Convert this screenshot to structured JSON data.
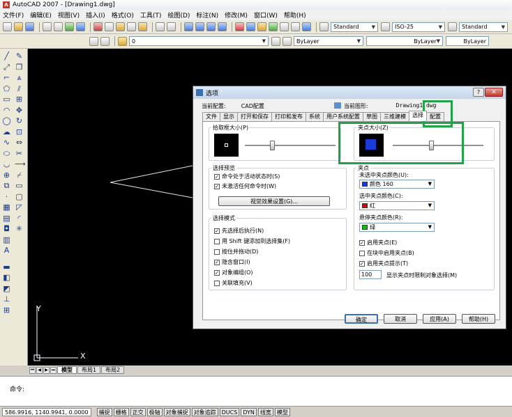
{
  "app": {
    "title": "AutoCAD 2007 - [Drawing1.dwg]",
    "logo": "A"
  },
  "menu": [
    "文件(F)",
    "编辑(E)",
    "视图(V)",
    "插入(I)",
    "格式(O)",
    "工具(T)",
    "绘图(D)",
    "标注(N)",
    "修改(M)",
    "窗口(W)",
    "帮助(H)"
  ],
  "toolbar": {
    "text_style": "Standard",
    "dim_style": "ISO-25",
    "table_style": "Standard",
    "layer_value": "0",
    "color": "ByLayer",
    "linetype": "ByLayer",
    "lineweight": "ByLayer"
  },
  "canvas": {
    "ucs_y": "Y",
    "ucs_x": "X"
  },
  "layout_tabs": {
    "nav": [
      "⏮",
      "◀",
      "▶",
      "⏭"
    ],
    "items": [
      "模型",
      "布局1",
      "布局2"
    ]
  },
  "command": {
    "prompt": "命令:"
  },
  "status": {
    "coords": "586.9916,  1140.9941, 0.0000",
    "buttons": [
      "捕捉",
      "栅格",
      "正交",
      "极轴",
      "对象捕捉",
      "对象追踪",
      "DUCS",
      "DYN",
      "线宽",
      "模型"
    ]
  },
  "dialog": {
    "title": "选项",
    "help_glyph": "?",
    "close_glyph": "✕",
    "current_profile_label": "当前配置:",
    "current_profile": "CAD配置",
    "current_drawing_label": "当前图形:",
    "current_drawing": "Drawing1.dwg",
    "tabs": [
      "文件",
      "显示",
      "打开和保存",
      "打印和发布",
      "系统",
      "用户系统配置",
      "草图",
      "三维建模",
      "选择",
      "配置"
    ],
    "active_tab": "选择",
    "pickbox": {
      "label": "拾取框大小(P)",
      "level": 0.3
    },
    "gripsize": {
      "label": "夹点大小(Z)",
      "level": 0.42
    },
    "selection_preview": {
      "label": "选择预览",
      "items": [
        {
          "label": "命令处于活动状态时(S)",
          "checked": true
        },
        {
          "label": "未激活任何命令时(W)",
          "checked": true
        }
      ],
      "button": "视觉效果设置(G)..."
    },
    "selection_modes": {
      "label": "选择模式",
      "items": [
        {
          "label": "先选择后执行(N)",
          "checked": true
        },
        {
          "label": "用 Shift 键添加到选择集(F)",
          "checked": false
        },
        {
          "label": "按住并拖动(D)",
          "checked": false
        },
        {
          "label": "隐含窗口(I)",
          "checked": true
        },
        {
          "label": "对象编组(O)",
          "checked": true
        },
        {
          "label": "关联填充(V)",
          "checked": false
        }
      ]
    },
    "grips": {
      "label": "夹点",
      "unselected_label": "未选中夹点颜色(U):",
      "unselected_value": "颜色 160",
      "unselected_color": "#1a3bd6",
      "selected_label": "选中夹点颜色(C):",
      "selected_value": "红",
      "selected_color": "#e00000",
      "hover_label": "悬停夹点颜色(R):",
      "hover_value": "绿",
      "hover_color": "#10c010",
      "checks": [
        {
          "label": "启用夹点(E)",
          "checked": true
        },
        {
          "label": "在块中启用夹点(B)",
          "checked": false
        },
        {
          "label": "启用夹点提示(T)",
          "checked": true
        }
      ],
      "limit_value": "100",
      "limit_label": "显示夹点时限制对象选择(M)"
    },
    "buttons": {
      "ok": "确定",
      "cancel": "取消",
      "apply": "应用(A)",
      "help": "帮助(H)"
    }
  },
  "colors": {
    "highlight": "#23a04a",
    "canvas": "#000000",
    "grip_preview": "#1a3bd6"
  }
}
